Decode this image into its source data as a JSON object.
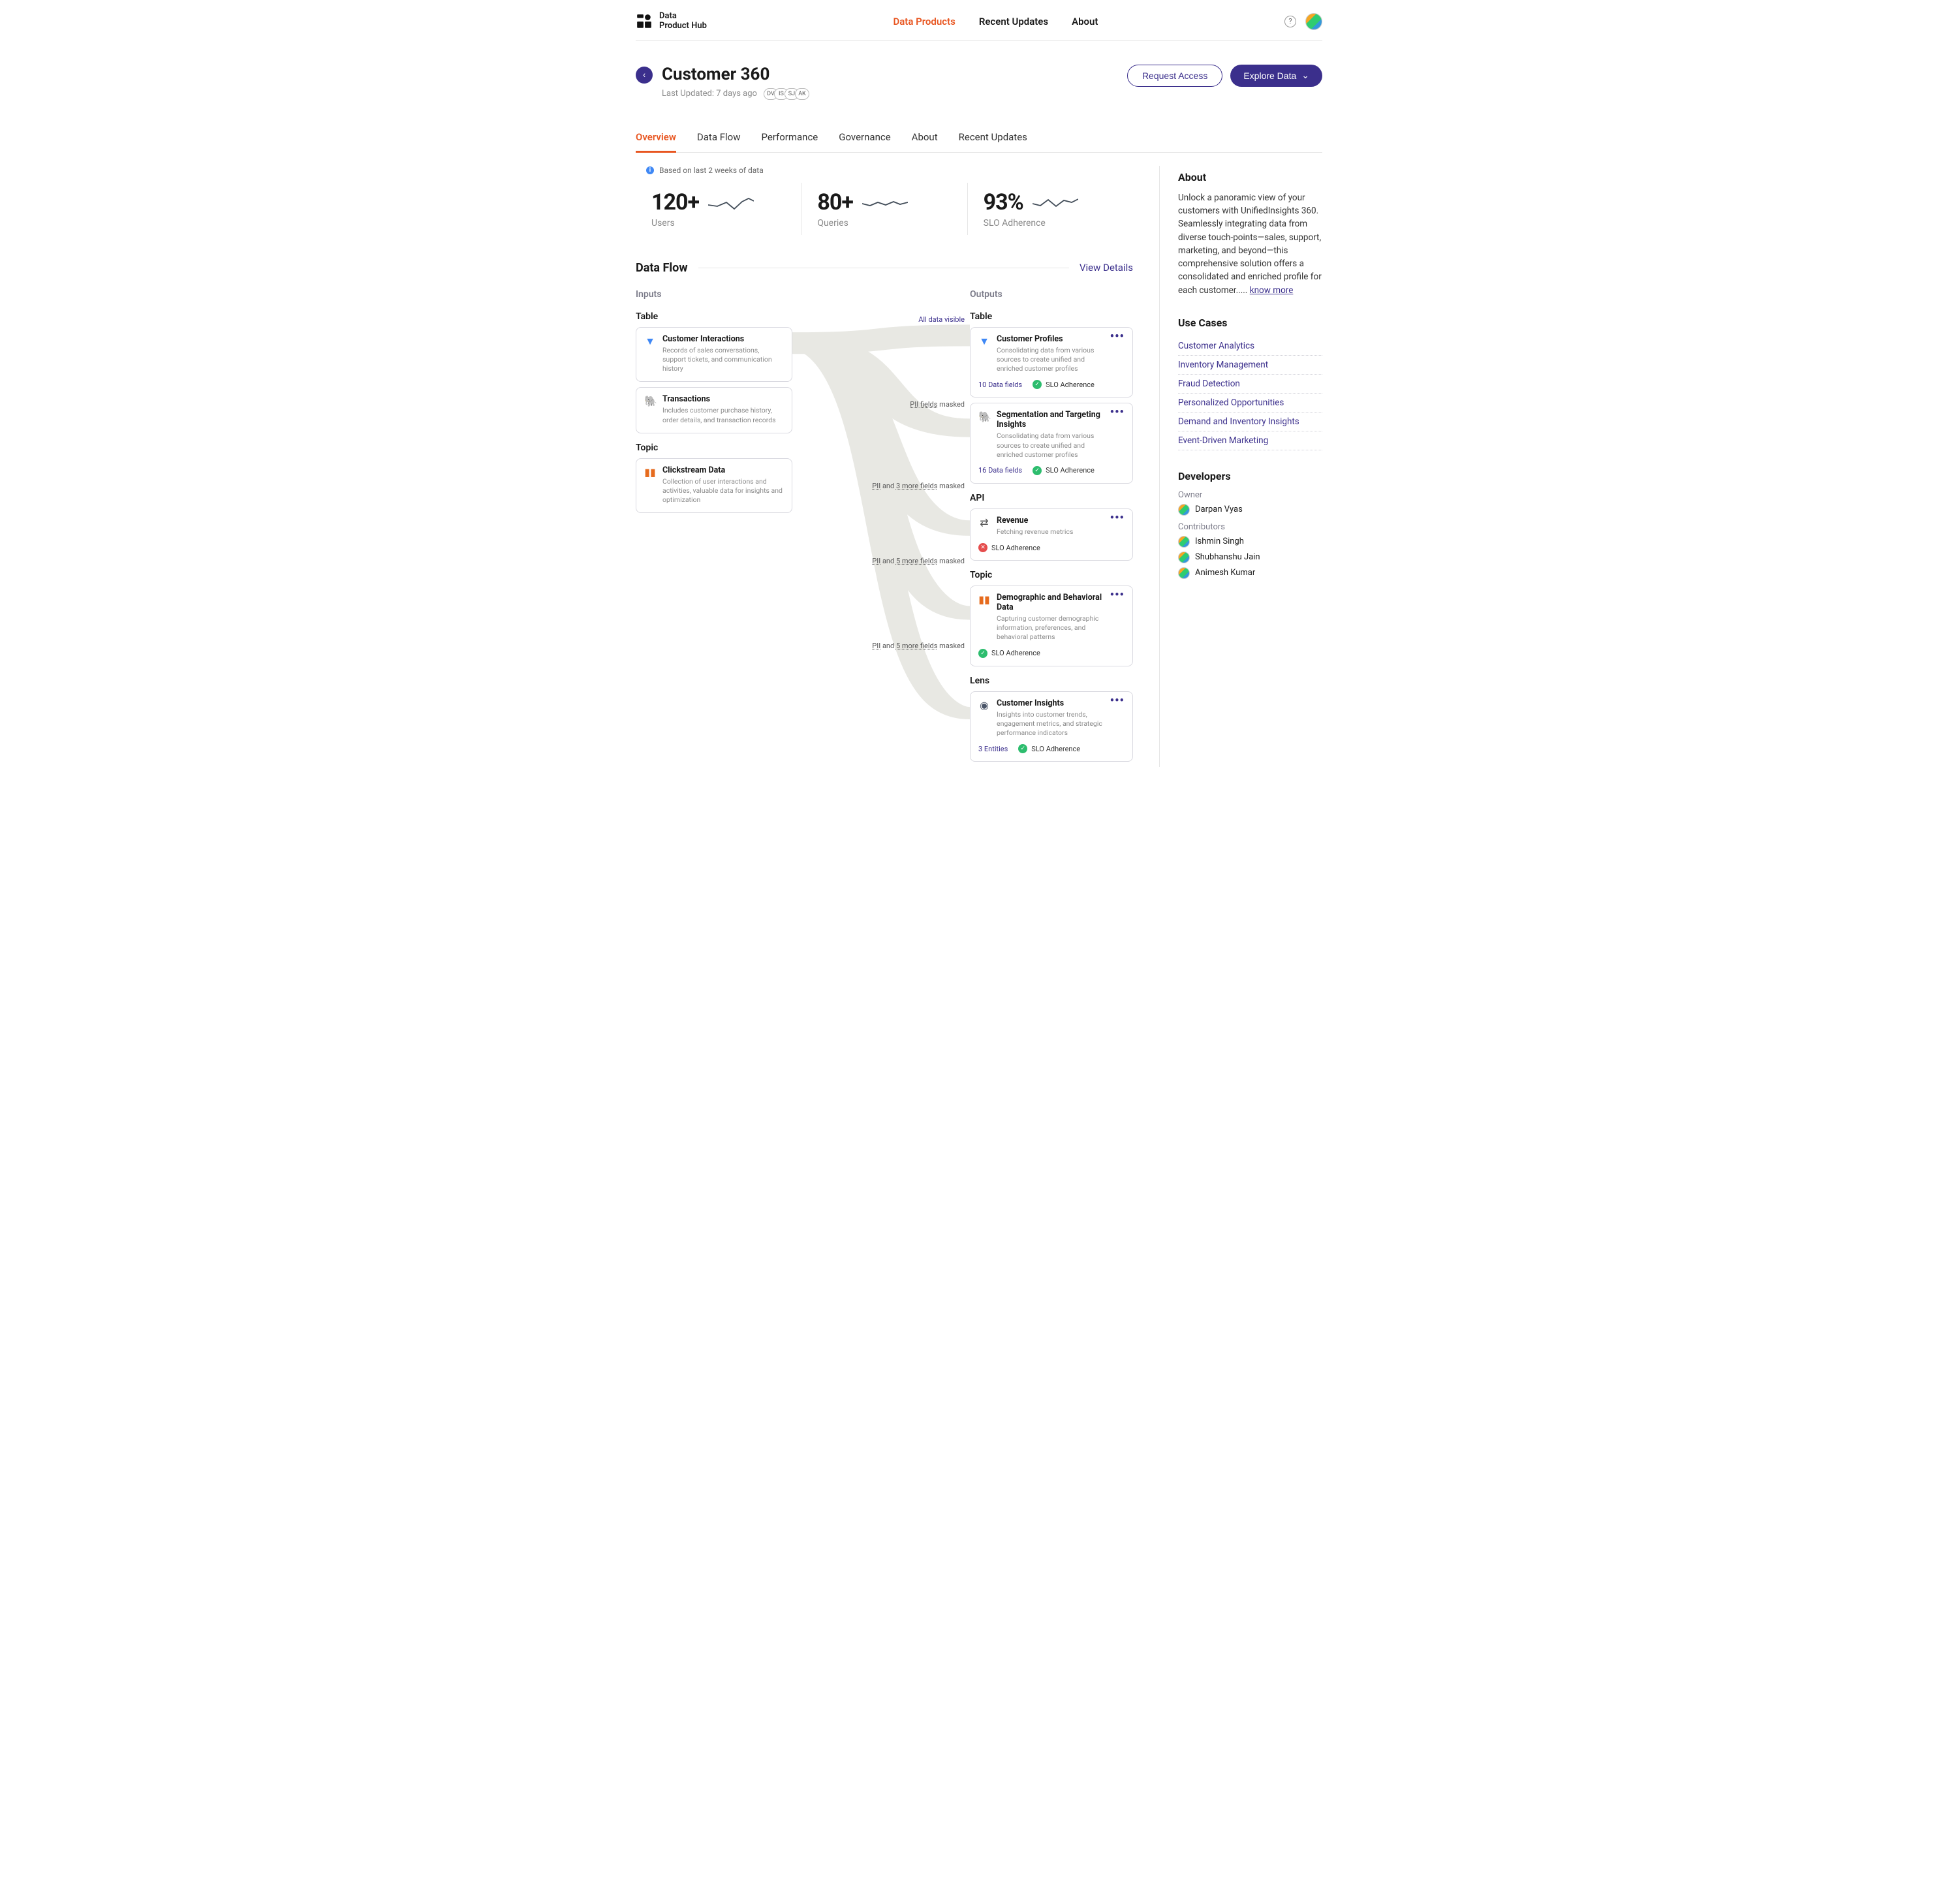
{
  "brand": {
    "line1": "Data",
    "line2": "Product Hub"
  },
  "nav": {
    "links": [
      "Data Products",
      "Recent Updates",
      "About"
    ],
    "active_index": 0
  },
  "header": {
    "title": "Customer 360",
    "last_updated": "Last Updated: 7 days ago",
    "chips": [
      "DV",
      "IS",
      "SJ",
      "AK"
    ],
    "request_access": "Request Access",
    "explore_data": "Explore Data"
  },
  "tabs": {
    "items": [
      "Overview",
      "Data Flow",
      "Performance",
      "Governance",
      "About",
      "Recent Updates"
    ],
    "active_index": 0
  },
  "stats": {
    "note": "Based on last 2 weeks of data",
    "users": {
      "value": "120+",
      "label": "Users"
    },
    "queries": {
      "value": "80+",
      "label": "Queries"
    },
    "slo": {
      "value": "93%",
      "label": "SLO Adherence"
    }
  },
  "dataflow": {
    "title": "Data Flow",
    "view_details": "View Details",
    "inputs_h": "Inputs",
    "outputs_h": "Outputs",
    "type_table": "Table",
    "type_topic": "Topic",
    "type_api": "API",
    "type_lens": "Lens",
    "inputs": [
      {
        "group": "Table",
        "icon": "▼",
        "iconClass": "ic-blue",
        "title": "Customer Interactions",
        "desc": "Records of sales conversations, support tickets, and communication history"
      },
      {
        "group": "Table",
        "icon": "🐘",
        "iconClass": "ic-pg",
        "title": "Transactions",
        "desc": "Includes customer purchase history, order details, and transaction records"
      },
      {
        "group": "Topic",
        "icon": "▮▮",
        "iconClass": "ic-orange",
        "title": "Clickstream Data",
        "desc": "Collection of user interactions and activities, valuable data for insights and optimization"
      }
    ],
    "edges": [
      {
        "label_html": "All data visible",
        "blue": true
      },
      {
        "label_html": "PII fields masked"
      },
      {
        "label_html": "PII and 3 more fields masked"
      },
      {
        "label_html": "PII and 5 more fields masked"
      },
      {
        "label_html": "PII and 5 more fields masked"
      }
    ],
    "outputs": [
      {
        "group": "Table",
        "icon": "▼",
        "iconClass": "ic-blue",
        "title": "Customer Profiles",
        "desc": "Consolidating data from various sources to create unified and enriched customer profiles",
        "fields": "10 Data fields",
        "sloLabel": "SLO Adherence",
        "sloOk": true
      },
      {
        "group": "Table",
        "icon": "🐘",
        "iconClass": "ic-pg",
        "title": "Segmentation and Targeting Insights",
        "desc": "Consolidating data from various sources to create unified and enriched customer profiles",
        "fields": "16 Data fields",
        "sloLabel": "SLO Adherence",
        "sloOk": true
      },
      {
        "group": "API",
        "icon": "⇄",
        "iconClass": "ic-rev",
        "title": "Revenue",
        "desc": "Fetching revenue metrics",
        "fields": "",
        "sloLabel": "SLO Adherence",
        "sloOk": false
      },
      {
        "group": "Topic",
        "icon": "▮▮",
        "iconClass": "ic-orange",
        "title": "Demographic and Behavioral Data",
        "desc": "Capturing customer demographic information, preferences, and behavioral patterns",
        "fields": "",
        "sloLabel": "SLO Adherence",
        "sloOk": true
      },
      {
        "group": "Lens",
        "icon": "◉",
        "iconClass": "ic-eye",
        "title": "Customer Insights",
        "desc": "Insights into customer trends, engagement metrics, and strategic performance indicators",
        "fields": "3 Entities",
        "sloLabel": "SLO Adherence",
        "sloOk": true
      }
    ]
  },
  "about": {
    "heading": "About",
    "text": "Unlock a panoramic view of your customers with UnifiedInsights 360. Seamlessly integrating data from diverse touch-points—sales, support, marketing, and beyond—this comprehensive solution offers a consolidated and enriched profile for each customer..... ",
    "know_more": "know more"
  },
  "use_cases": {
    "heading": "Use Cases",
    "items": [
      "Customer Analytics",
      "Inventory Management",
      "Fraud Detection",
      "Personalized Opportunities",
      "Demand and Inventory Insights",
      "Event-Driven Marketing"
    ]
  },
  "developers": {
    "heading": "Developers",
    "owner_h": "Owner",
    "owner": "Darpan Vyas",
    "contrib_h": "Contributors",
    "contributors": [
      "Ishmin Singh",
      "Shubhanshu Jain",
      "Animesh Kumar"
    ]
  }
}
